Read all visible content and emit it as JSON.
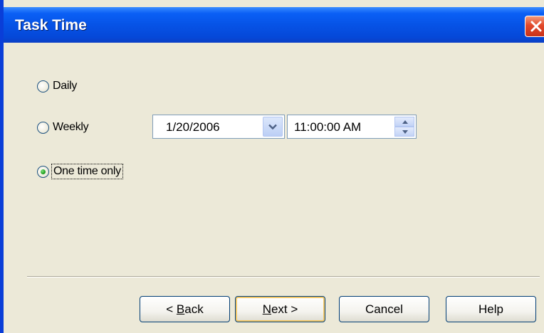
{
  "window": {
    "title": "Task Time"
  },
  "schedule": {
    "options": [
      {
        "label": "Daily",
        "checked": false
      },
      {
        "label": "Weekly",
        "checked": false
      },
      {
        "label": "One time only",
        "checked": true
      }
    ],
    "date_value": "1/20/2006",
    "time_value": "11:00:00 AM"
  },
  "buttons": {
    "back_prefix": "< ",
    "back_mnemonic": "B",
    "back_rest": "ack",
    "next_mnemonic": "N",
    "next_rest": "ext >",
    "cancel": "Cancel",
    "help": "Help"
  },
  "icons": {
    "close": "close-icon",
    "dropdown": "chevron-down-icon",
    "spin_up": "spin-up-icon",
    "spin_down": "spin-down-icon"
  },
  "colors": {
    "titlebar": "#0653e6",
    "dialog_bg": "#ece9d8",
    "close_button": "#e2492b",
    "radio_selected": "#21a121",
    "default_button_glow": "#f2c86a"
  }
}
